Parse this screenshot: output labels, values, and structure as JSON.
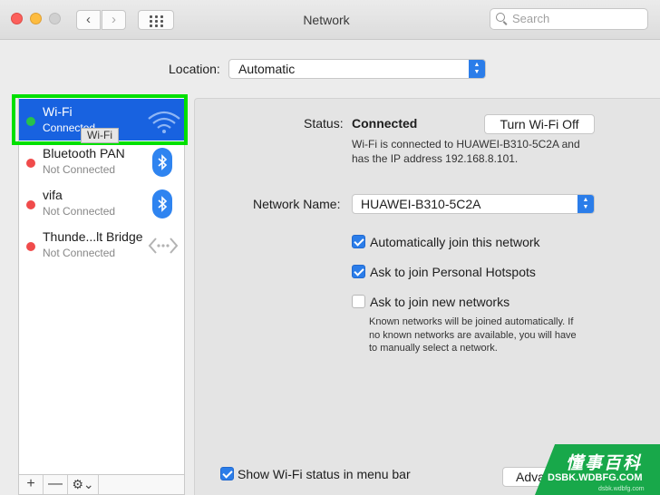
{
  "window": {
    "title": "Network"
  },
  "toolbar": {
    "back_glyph": "‹",
    "forward_glyph": "›",
    "search_placeholder": "Search"
  },
  "location": {
    "label": "Location:",
    "value": "Automatic"
  },
  "services": [
    {
      "name": "Wi-Fi",
      "status": "Connected",
      "status_color": "#27c24a",
      "selected": true,
      "icon": "wifi-icon"
    },
    {
      "name": "Bluetooth PAN",
      "status": "Not Connected",
      "status_color": "#f04b4b",
      "icon": "bluetooth-icon"
    },
    {
      "name": "vifa",
      "status": "Not Connected",
      "status_color": "#f04b4b",
      "icon": "bluetooth-icon"
    },
    {
      "name": "Thunde...lt Bridge",
      "status": "Not Connected",
      "status_color": "#f04b4b",
      "icon": "thunderbolt-bridge-icon"
    }
  ],
  "tooltip": "Wi-Fi",
  "list_actions": {
    "add": "+",
    "remove": "—",
    "more": "⚙⌄"
  },
  "detail": {
    "status_label": "Status:",
    "status_value": "Connected",
    "toggle_button": "Turn Wi-Fi Off",
    "status_desc_line1": "Wi-Fi is connected to HUAWEI-B310-5C2A and",
    "status_desc_line2": "has the IP address 192.168.8.101.",
    "network_name_label": "Network Name:",
    "network_name_value": "HUAWEI-B310-5C2A",
    "options": [
      {
        "label": "Automatically join this network",
        "checked": true
      },
      {
        "label": "Ask to join Personal Hotspots",
        "checked": true
      },
      {
        "label": "Ask to join new networks",
        "checked": false
      }
    ],
    "known_line1": "Known networks will be joined automatically. If",
    "known_line2": "no known networks are available, you will have",
    "known_line3": "to manually select a network.",
    "show_status_label": "Show Wi-Fi status in menu bar",
    "show_status_checked": true,
    "advanced_button": "Adva"
  },
  "watermark": {
    "chinese": "懂事百科",
    "site": "DSBK.WDBFG.COM",
    "tiny": "dsbk.wdbfg.com"
  },
  "colors": {
    "accent": "#2b7de9",
    "selection": "#1862e0",
    "highlight_frame": "#00e000"
  }
}
